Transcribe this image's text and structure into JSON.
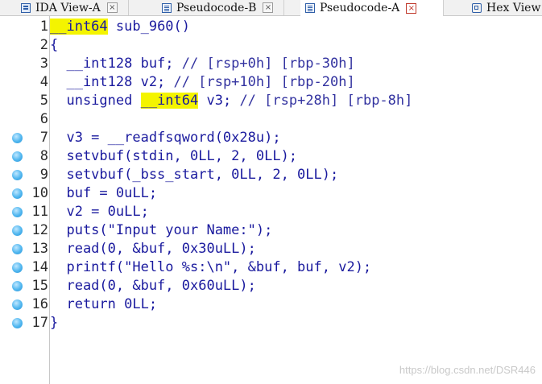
{
  "tabs": [
    {
      "label": "IDA View-A",
      "icon": "ida-view-icon"
    },
    {
      "label": "Pseudocode-B",
      "icon": "pseudocode-icon"
    },
    {
      "label": "Pseudocode-A",
      "icon": "pseudocode-icon",
      "active": true
    },
    {
      "label": "Hex View",
      "icon": "hex-view-icon"
    }
  ],
  "close_glyph": "×",
  "line_numbers": [
    "1",
    "2",
    "3",
    "4",
    "5",
    "6",
    "7",
    "8",
    "9",
    "10",
    "11",
    "12",
    "13",
    "14",
    "15",
    "16",
    "17"
  ],
  "breakpoint_lines": [
    7,
    8,
    9,
    10,
    11,
    12,
    13,
    14,
    15,
    16,
    17
  ],
  "code": {
    "l1": {
      "kw": "__int64",
      "rest": " sub_960()"
    },
    "l2": "{",
    "l3": {
      "code": "  __int128 buf; ",
      "comment": "// [rsp+0h] [rbp-30h]"
    },
    "l4": {
      "code": "  __int128 v2; ",
      "comment": "// [rsp+10h] [rbp-20h]"
    },
    "l5": {
      "pre": "  unsigned ",
      "kw": "__int64",
      "code": " v3; ",
      "comment": "// [rsp+28h] [rbp-8h]"
    },
    "l6": "",
    "l7": "  v3 = __readfsqword(0x28u);",
    "l8": "  setvbuf(stdin, 0LL, 2, 0LL);",
    "l9": "  setvbuf(_bss_start, 0LL, 2, 0LL);",
    "l10": "  buf = 0uLL;",
    "l11": "  v2 = 0uLL;",
    "l12": "  puts(\"Input your Name:\");",
    "l13": "  read(0, &buf, 0x30uLL);",
    "l14": "  printf(\"Hello %s:\\n\", &buf, buf, v2);",
    "l15": "  read(0, &buf, 0x60uLL);",
    "l16": "  return 0LL;",
    "l17": "}"
  },
  "watermark": "https://blog.csdn.net/DSR446",
  "colors": {
    "highlight": "#f4f400",
    "code": "#1a1a9e",
    "breakpoint": "#4fb6ef"
  }
}
